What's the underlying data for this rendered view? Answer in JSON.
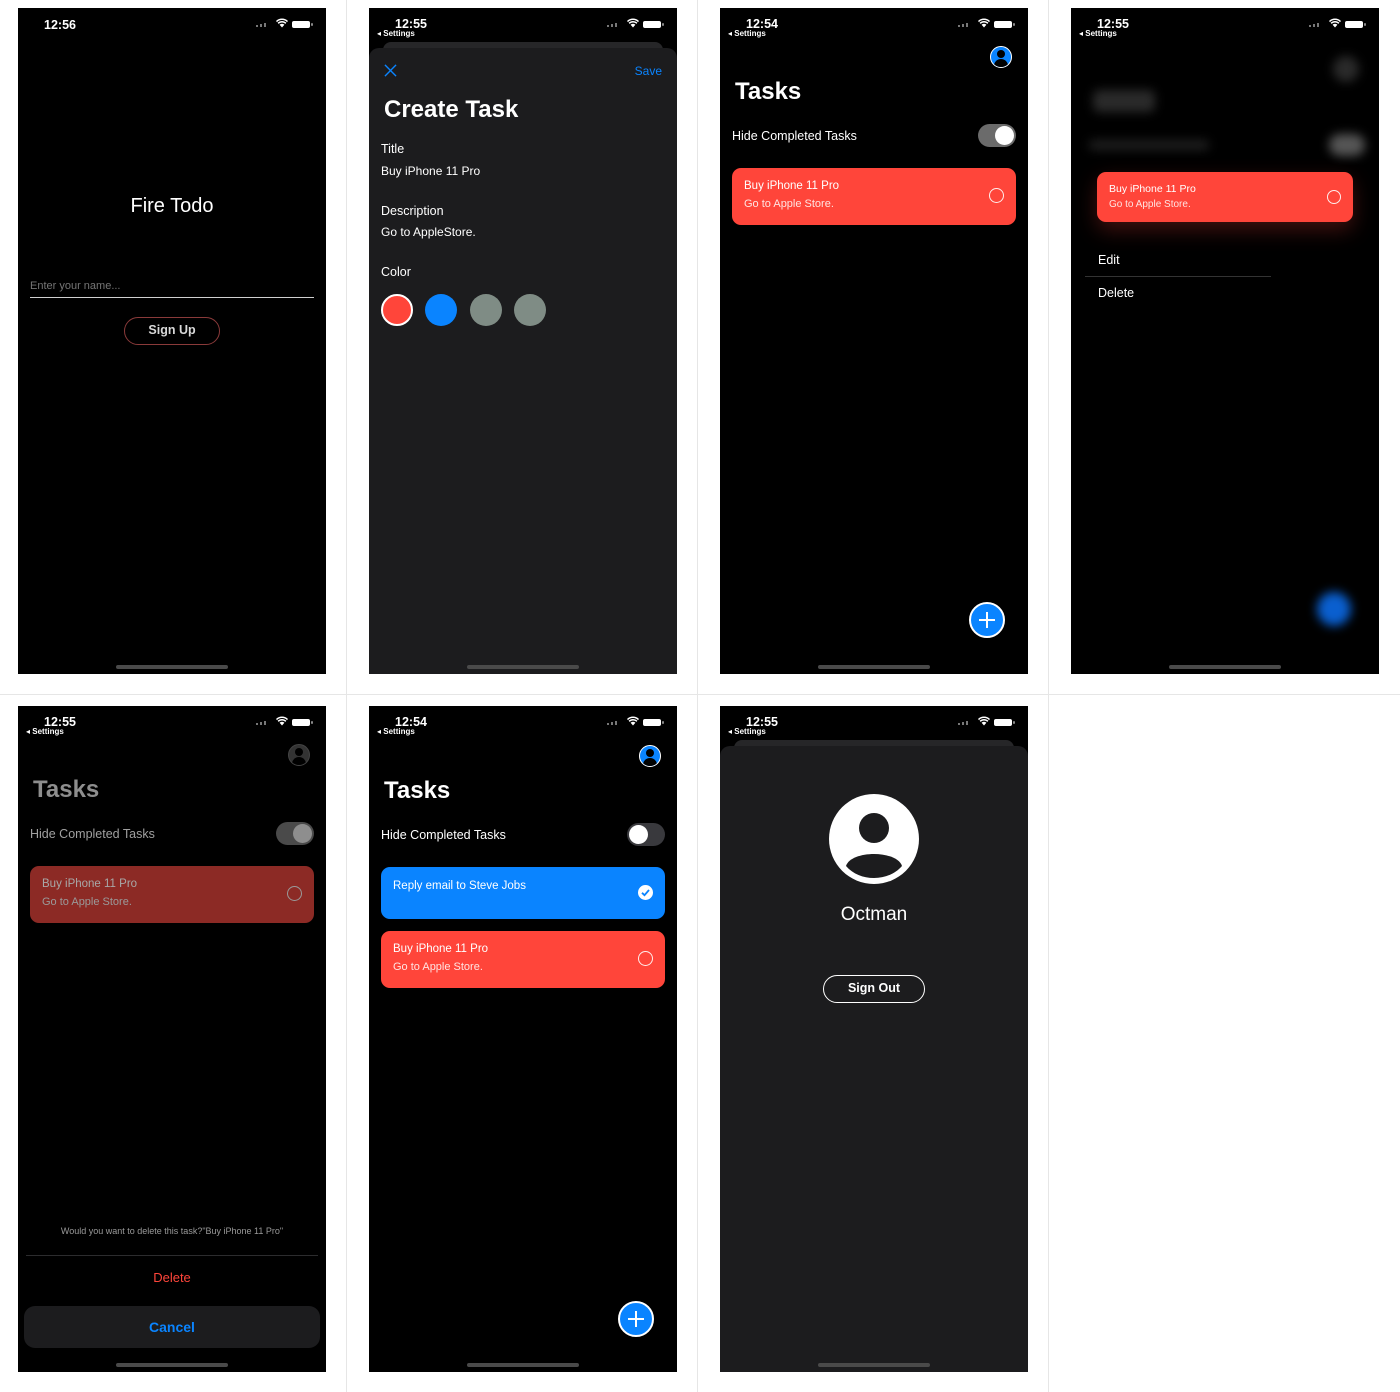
{
  "screens": {
    "login": {
      "time": "12:56",
      "app_title": "Fire Todo",
      "name_placeholder": "Enter your name...",
      "sign_up_label": "Sign Up"
    },
    "create_task": {
      "time": "12:55",
      "back_label": "◂ Settings",
      "save_label": "Save",
      "heading": "Create Task",
      "title_label": "Title",
      "title_value": "Buy iPhone 11 Pro",
      "description_label": "Description",
      "description_value": "Go to AppleStore.",
      "color_label": "Color",
      "colors": [
        "#ff453a",
        "#0a84ff",
        "#7f8c85",
        "#7f8c85"
      ],
      "selected_color_index": 0
    },
    "tasks_1": {
      "time": "12:54",
      "back_label": "◂ Settings",
      "heading": "Tasks",
      "hide_label": "Hide Completed Tasks",
      "hide_on": true,
      "task": {
        "title": "Buy iPhone 11 Pro",
        "description": "Go to Apple Store."
      }
    },
    "context_menu": {
      "time": "12:55",
      "back_label": "◂ Settings",
      "task": {
        "title": "Buy iPhone 11 Pro",
        "description": "Go to Apple Store."
      },
      "edit_label": "Edit",
      "delete_label": "Delete"
    },
    "delete_confirm": {
      "time": "12:55",
      "back_label": "◂ Settings",
      "heading": "Tasks",
      "hide_label": "Hide Completed Tasks",
      "task": {
        "title": "Buy iPhone 11 Pro",
        "description": "Go to Apple Store."
      },
      "message": "Would you want to delete this task?\"Buy iPhone 11 Pro\"",
      "delete_label": "Delete",
      "cancel_label": "Cancel"
    },
    "tasks_2": {
      "time": "12:54",
      "back_label": "◂ Settings",
      "heading": "Tasks",
      "hide_label": "Hide Completed Tasks",
      "hide_on": false,
      "tasks": [
        {
          "title": "Reply email to Steve Jobs",
          "description": "",
          "color": "#0a84ff",
          "done": true
        },
        {
          "title": "Buy iPhone 11 Pro",
          "description": "Go to Apple Store.",
          "color": "#ff453a",
          "done": false
        }
      ]
    },
    "profile": {
      "time": "12:55",
      "back_label": "◂ Settings",
      "user_name": "Octman",
      "sign_out_label": "Sign Out"
    }
  },
  "colors": {
    "accent": "#0a84ff",
    "red": "#ff453a",
    "background": "#000000",
    "sheet": "#1c1c1e"
  }
}
